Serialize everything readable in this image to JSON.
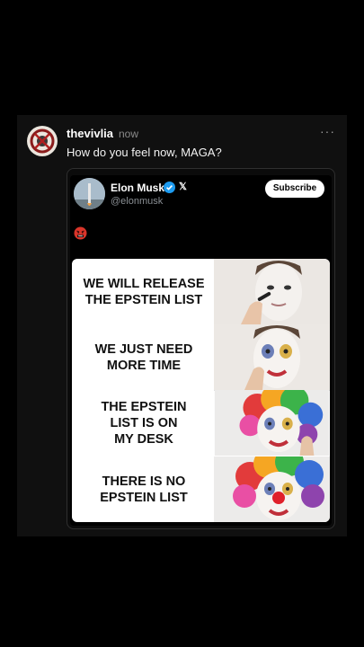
{
  "post": {
    "username": "thevivlia",
    "timestamp": "now",
    "more": "···",
    "text": "How do you feel now, MAGA?"
  },
  "embed": {
    "name": "Elon Musk",
    "handle": "@elonmusk",
    "x_logo": "𝕏",
    "subscribe_label": "Subscribe",
    "emoji": "angry-face-with-symbols",
    "meme_lines": [
      "WE WILL RELEASE\nTHE EPSTEIN LIST",
      "WE JUST NEED\nMORE TIME",
      "THE EPSTEIN\nLIST IS ON\nMY DESK",
      "THERE IS NO\nEPSTEIN LIST"
    ]
  },
  "colors": {
    "background": "#000000",
    "card": "#101010",
    "verified": "#1d9bf0",
    "muted": "#8a8a8a"
  }
}
